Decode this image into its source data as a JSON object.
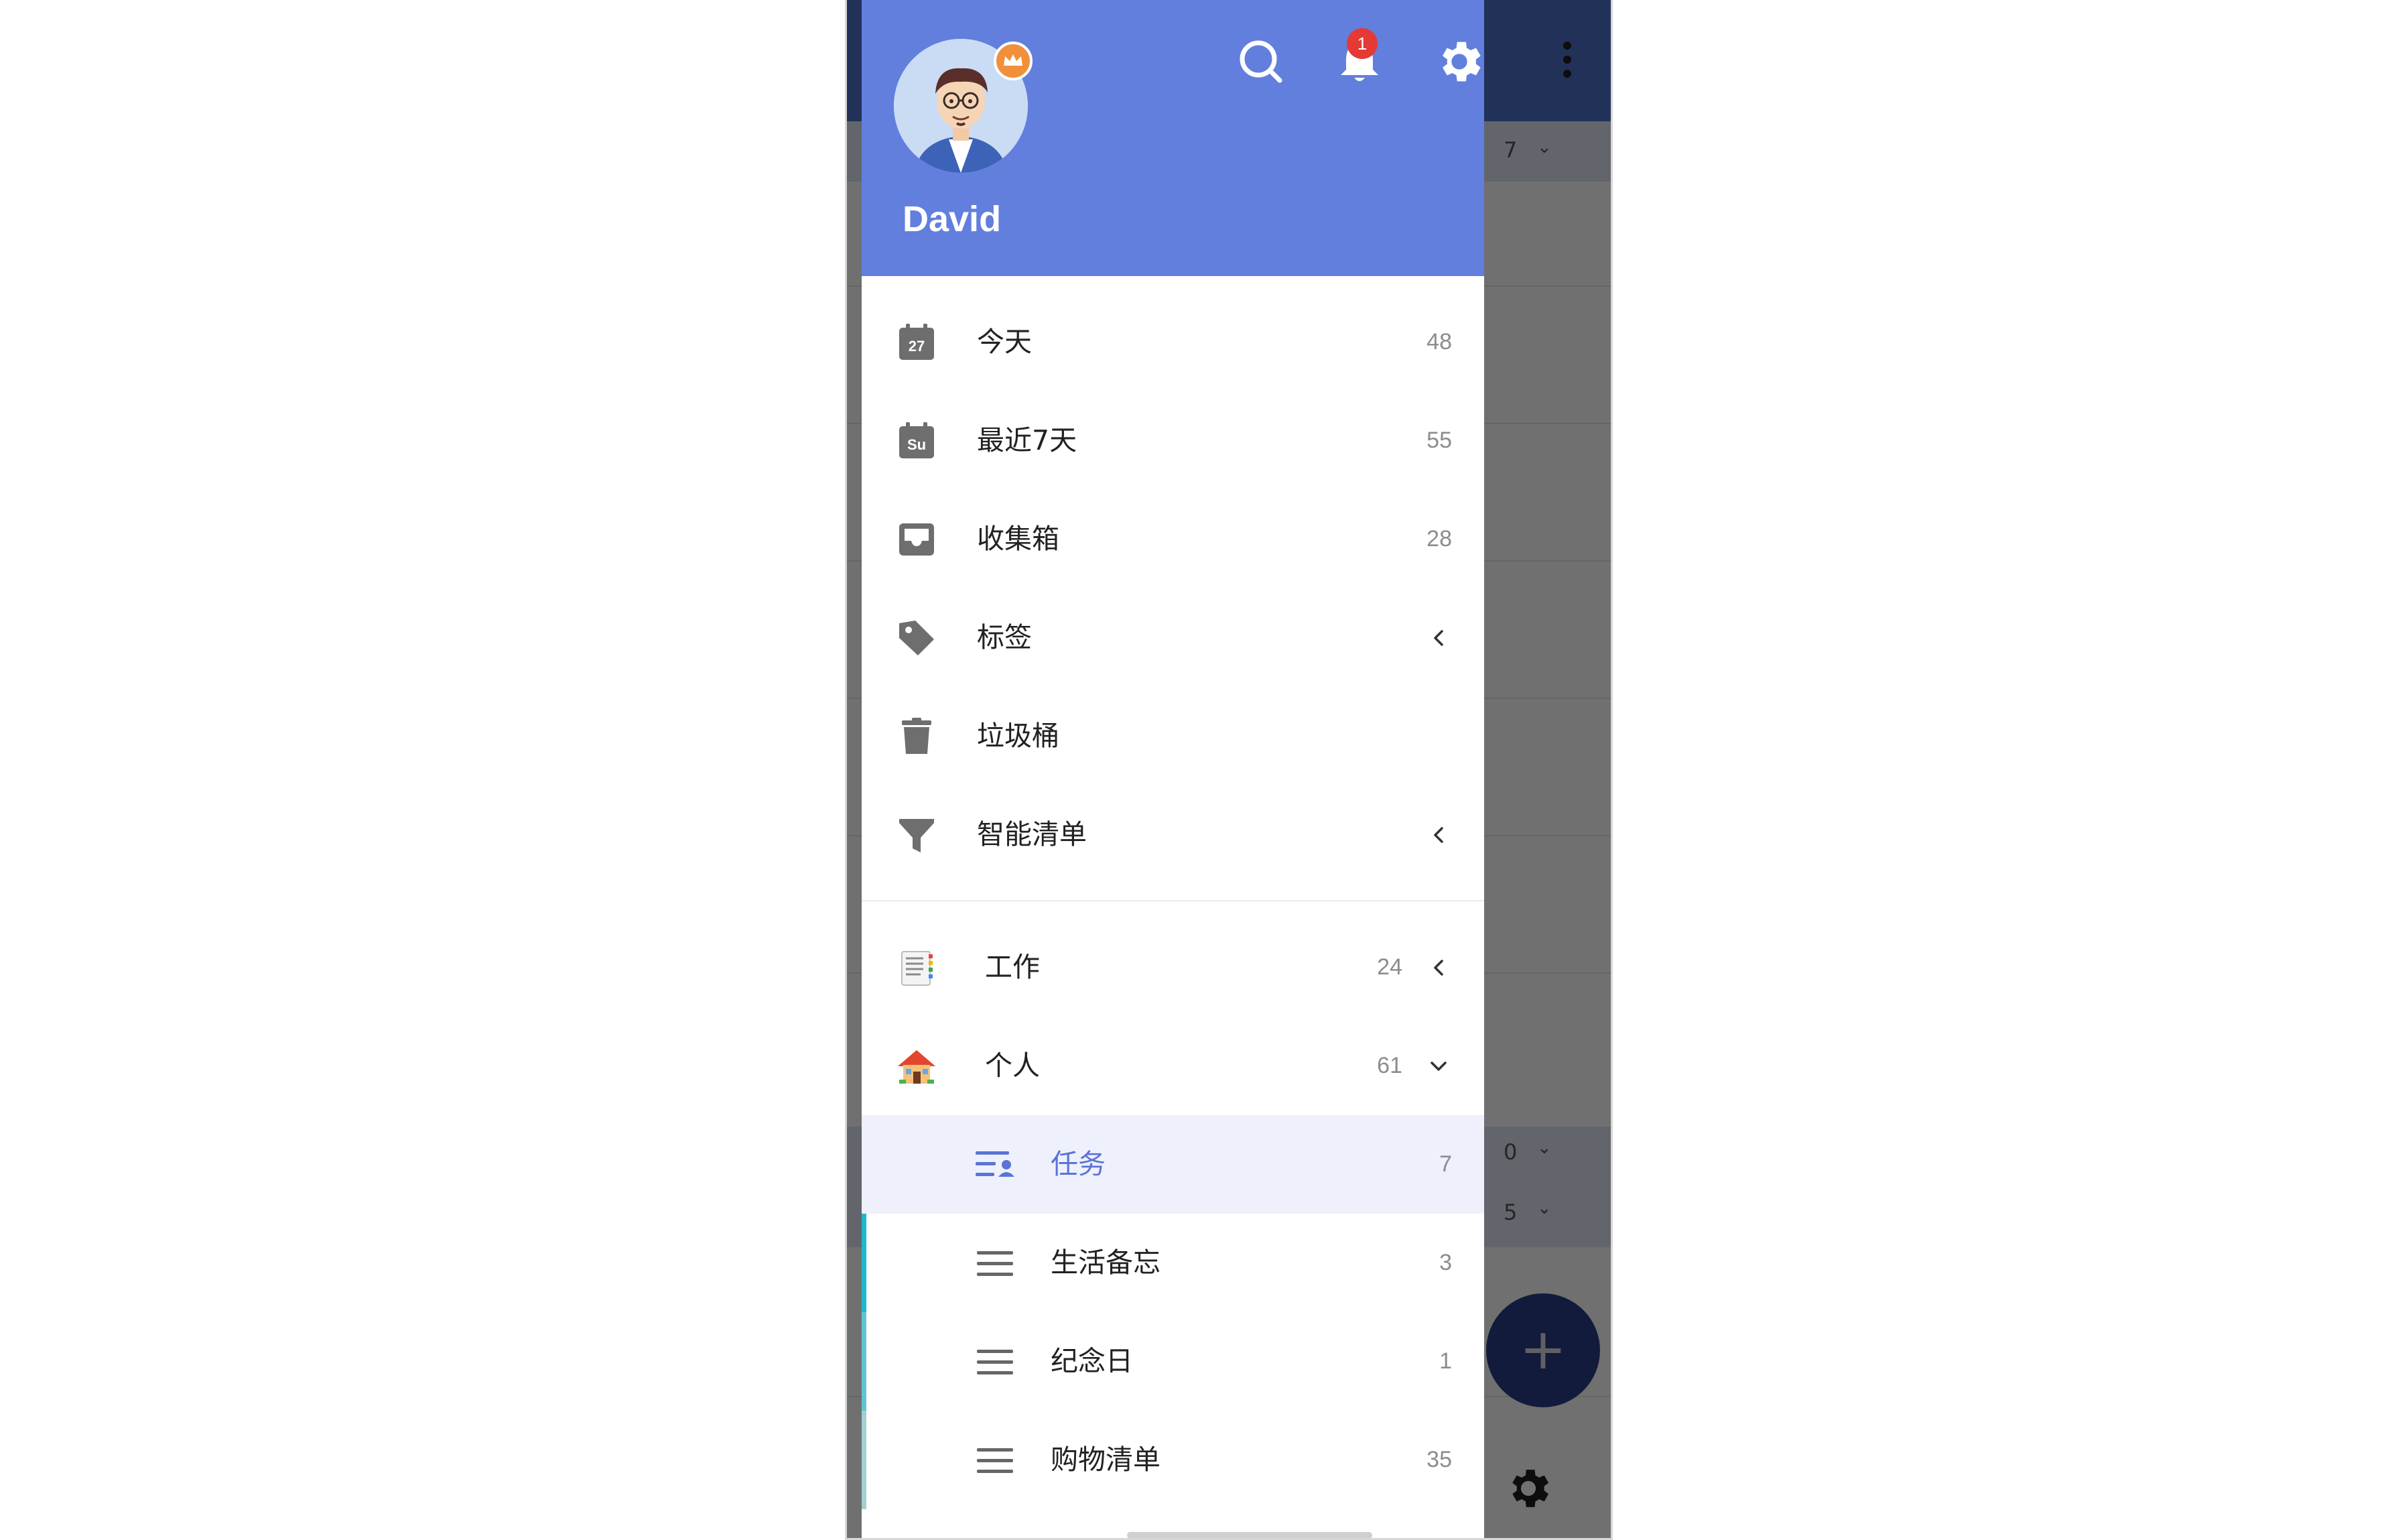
{
  "header": {
    "username": "David",
    "notification_count": "1",
    "icons": [
      "search-icon",
      "bell-icon",
      "gear-icon"
    ]
  },
  "smart_items": [
    {
      "label": "今天",
      "count": "48",
      "icon": "calendar-27-icon",
      "icon_text": "27"
    },
    {
      "label": "最近7天",
      "count": "55",
      "icon": "calendar-su-icon",
      "icon_text": "Su"
    },
    {
      "label": "收集箱",
      "count": "28",
      "icon": "inbox-icon"
    },
    {
      "label": "标签",
      "count": "",
      "icon": "tag-icon"
    },
    {
      "label": "垃圾桶",
      "count": "",
      "icon": "trash-icon"
    },
    {
      "label": "智能清单",
      "count": "",
      "icon": "filter-icon"
    }
  ],
  "folders": [
    {
      "label": "工作",
      "count": "24",
      "icon": "notepad-emoji-icon",
      "expanded": false
    },
    {
      "label": "个人",
      "count": "61",
      "icon": "house-emoji-icon",
      "expanded": true
    }
  ],
  "lists": [
    {
      "label": "任务",
      "count": "7",
      "active": true,
      "stripe_color": ""
    },
    {
      "label": "生活备忘",
      "count": "3",
      "active": false,
      "stripe_color": "#1fb7cf"
    },
    {
      "label": "纪念日",
      "count": "1",
      "active": false,
      "stripe_color": "#62c3d6"
    },
    {
      "label": "购物清单",
      "count": "35",
      "active": false,
      "stripe_color": "#a3cfd1"
    }
  ],
  "background_app": {
    "counts": [
      "7",
      "0",
      "5"
    ],
    "fab_label": "+"
  },
  "colors": {
    "header": "#627fde",
    "active_bg": "#eef0fc",
    "active_text": "#5a73d6",
    "badge": "#e53935",
    "icon_gray": "#6e6e6e"
  }
}
